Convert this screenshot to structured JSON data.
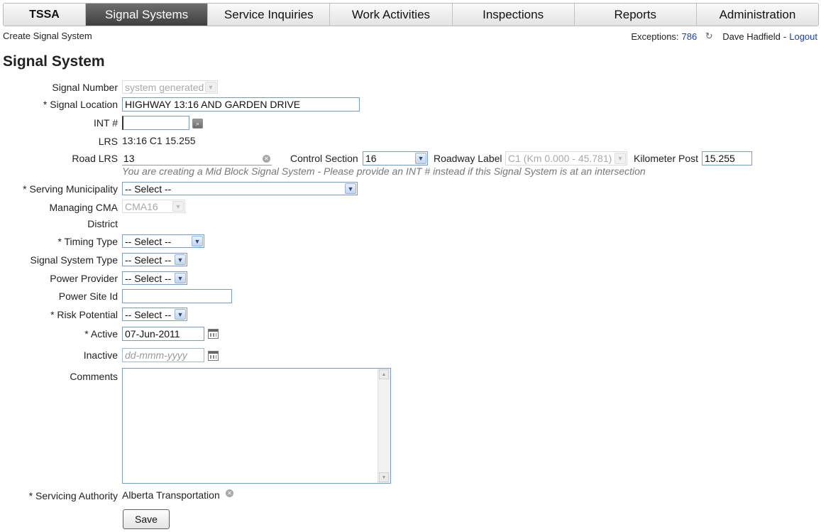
{
  "nav": {
    "brand": "TSSA",
    "tabs": [
      "Signal Systems",
      "Service Inquiries",
      "Work Activities",
      "Inspections",
      "Reports",
      "Administration"
    ],
    "active_tab": "Signal Systems",
    "active_color": "#4f4f4f"
  },
  "breadcrumb": "Create Signal System",
  "userbar": {
    "exceptions_label": "Exceptions:",
    "exceptions_count": "786",
    "user_name": "Dave Hadfield",
    "separator": "-",
    "logout_label": "Logout"
  },
  "page_title": "Signal System",
  "form": {
    "signal_number": {
      "label": "Signal Number",
      "value": "system generated"
    },
    "signal_location": {
      "label": "* Signal Location",
      "value": "HIGHWAY 13:16 AND GARDEN DRIVE"
    },
    "int_number": {
      "label": "INT #",
      "value": ""
    },
    "lrs": {
      "label": "LRS",
      "value": "13:16 C1 15.255"
    },
    "road_lrs": {
      "label": "Road LRS",
      "value": "13"
    },
    "control_section": {
      "label": "Control Section",
      "value": "16"
    },
    "roadway_label": {
      "label": "Roadway Label",
      "value": "C1 (Km 0.000 - 45.781)"
    },
    "kilometer_post": {
      "label": "Kilometer Post",
      "value": "15.255"
    },
    "mid_block_hint": "You are creating a Mid Block Signal System - Please provide an INT # instead if this Signal System is at an intersection",
    "serving_municipality": {
      "label": "* Serving Municipality",
      "value": "-- Select --"
    },
    "managing_cma": {
      "label": "Managing CMA",
      "value": "CMA16"
    },
    "district": {
      "label": "District",
      "value": ""
    },
    "timing_type": {
      "label": "* Timing Type",
      "value": "-- Select --"
    },
    "signal_system_type": {
      "label": "Signal System Type",
      "value": "-- Select --"
    },
    "power_provider": {
      "label": "Power Provider",
      "value": "-- Select --"
    },
    "power_site_id": {
      "label": "Power Site Id",
      "value": ""
    },
    "risk_potential": {
      "label": "* Risk Potential",
      "value": "-- Select --"
    },
    "active": {
      "label": "* Active",
      "value": "07-Jun-2011"
    },
    "inactive": {
      "label": "Inactive",
      "value": "",
      "placeholder": "dd-mmm-yyyy"
    },
    "comments": {
      "label": "Comments",
      "value": ""
    },
    "servicing_authority": {
      "label": "* Servicing Authority",
      "value": "Alberta Transportation"
    }
  },
  "save_label": "Save",
  "icons": {
    "lookup": "magnifier-icon",
    "calendar": "calendar-icon",
    "clear": "clear-x-icon",
    "dropdown": "chevron-down-icon",
    "refresh": "refresh-icon"
  }
}
